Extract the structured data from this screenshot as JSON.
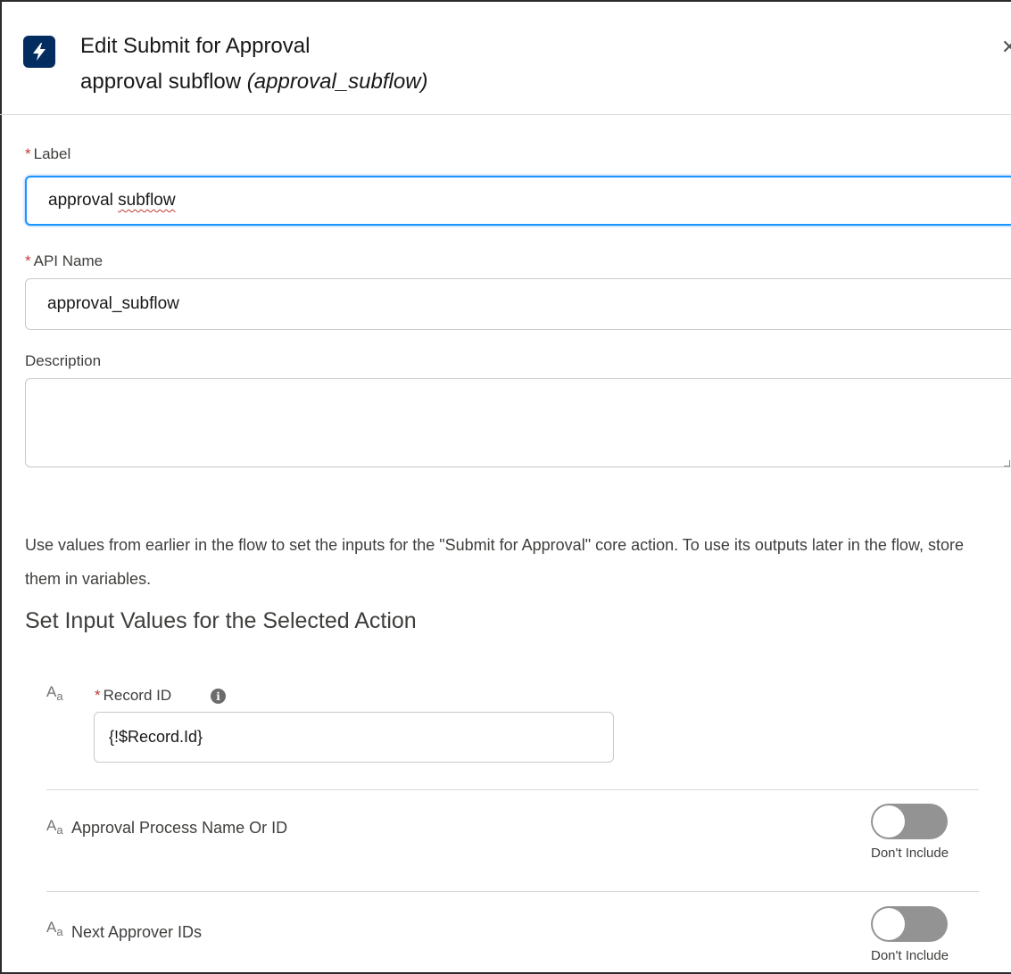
{
  "header": {
    "title": "Edit Submit for Approval",
    "subtitle_label": "approval subflow",
    "subtitle_api": "(approval_subflow)",
    "icon": "lightning-bolt-icon",
    "close_icon": "close-icon",
    "close_glyph": "✕"
  },
  "form": {
    "label": {
      "required": "*",
      "label": "Label",
      "value_plain": "approval ",
      "value_misspelled": "subflow"
    },
    "api_name": {
      "required": "*",
      "label": "API Name",
      "value": "approval_subflow"
    },
    "description": {
      "label": "Description",
      "value": ""
    }
  },
  "help_text": "Use values from earlier in the flow to set the inputs for the \"Submit for Approval\" core action. To use its outputs later in the flow, store them in variables.",
  "section_title": "Set Input Values for the Selected Action",
  "inputs": {
    "type_icon_main": "A",
    "type_icon_sub": "a",
    "record_id": {
      "required": "*",
      "label": "Record ID",
      "info_glyph": "i",
      "value": "{!$Record.Id}"
    },
    "approval_process": {
      "label": "Approval Process Name Or ID",
      "toggle_state": "off",
      "toggle_caption": "Don't Include"
    },
    "next_approver": {
      "label": "Next Approver IDs",
      "toggle_state": "off",
      "toggle_caption": "Don't Include"
    }
  },
  "colors": {
    "icon_background": "#032d60",
    "focus_border": "#1b96ff",
    "required": "#c23934",
    "toggle_off": "#939393"
  }
}
